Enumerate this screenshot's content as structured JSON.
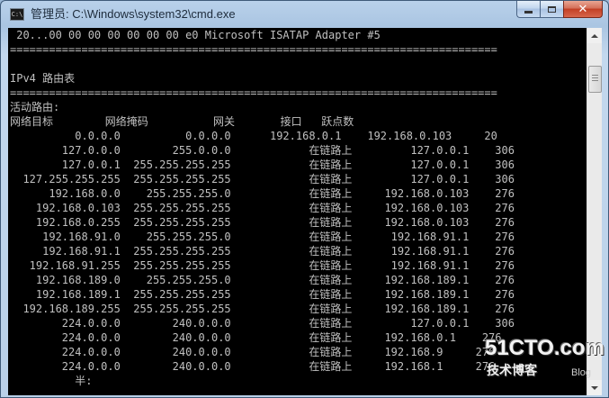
{
  "window": {
    "title": "管理员: C:\\Windows\\system32\\cmd.exe",
    "app_icon_text": "C:\\"
  },
  "caption": {
    "minimize_icon": "minimize-icon",
    "maximize_icon": "maximize-icon",
    "close_icon": "close-icon",
    "close_glyph": "✕"
  },
  "console": {
    "lines": [
      " 20...00 00 00 00 00 00 00 e0 Microsoft ISATAP Adapter #5",
      "===========================================================================",
      "",
      "IPv4 路由表",
      "===========================================================================",
      "活动路由:",
      "网络目标        网络掩码          网关       接口   跃点数",
      "          0.0.0.0          0.0.0.0      192.168.0.1    192.168.0.103     20",
      "        127.0.0.0        255.0.0.0            在链路上         127.0.0.1    306",
      "        127.0.0.1  255.255.255.255            在链路上         127.0.0.1    306",
      "  127.255.255.255  255.255.255.255            在链路上         127.0.0.1    306",
      "      192.168.0.0    255.255.255.0            在链路上     192.168.0.103    276",
      "    192.168.0.103  255.255.255.255            在链路上     192.168.0.103    276",
      "    192.168.0.255  255.255.255.255            在链路上     192.168.0.103    276",
      "     192.168.91.0    255.255.255.0            在链路上      192.168.91.1    276",
      "     192.168.91.1  255.255.255.255            在链路上      192.168.91.1    276",
      "   192.168.91.255  255.255.255.255            在链路上      192.168.91.1    276",
      "    192.168.189.0    255.255.255.0            在链路上     192.168.189.1    276",
      "    192.168.189.1  255.255.255.255            在链路上     192.168.189.1    276",
      "  192.168.189.255  255.255.255.255            在链路上     192.168.189.1    276",
      "        224.0.0.0        240.0.0.0            在链路上         127.0.0.1    306",
      "        224.0.0.0        240.0.0.0            在链路上     192.168.0.1    276",
      "        224.0.0.0        240.0.0.0            在链路上     192.168.9     276",
      "        224.0.0.0        240.0.0.0            在链路上     192.168.1     276",
      "          半:"
    ]
  },
  "watermark": {
    "main": "51CTO.com",
    "sub": "技术博客",
    "blog": "Blog"
  }
}
